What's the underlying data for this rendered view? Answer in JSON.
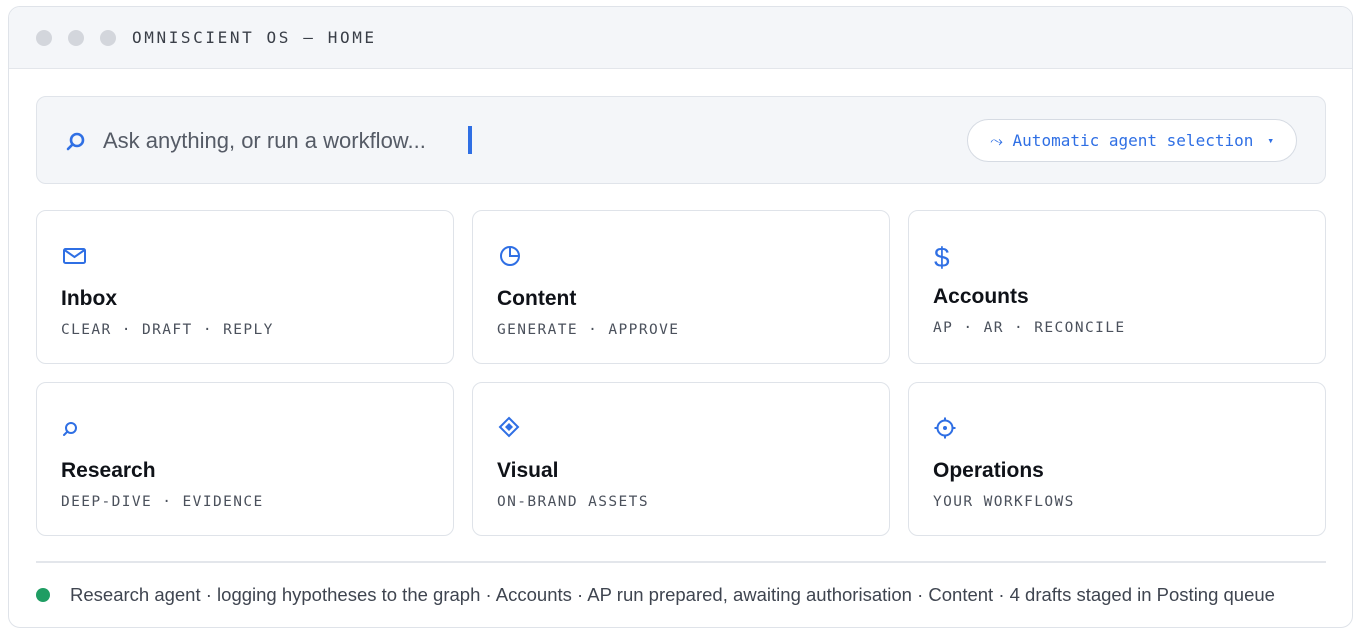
{
  "window": {
    "title": "OMNISCIENT OS — HOME"
  },
  "search": {
    "placeholder": "Ask anything, or run a workflow...",
    "agent_selector": {
      "label": "⤳ Automatic agent selection",
      "chevron": "▾"
    }
  },
  "cards": [
    {
      "title": "Inbox",
      "subtitle": "CLEAR · DRAFT · REPLY",
      "icon": "mail-icon"
    },
    {
      "title": "Content",
      "subtitle": "GENERATE · APPROVE",
      "icon": "pie-chart-icon"
    },
    {
      "title": "Accounts",
      "subtitle": "AP · AR · RECONCILE",
      "icon": "dollar-icon"
    },
    {
      "title": "Research",
      "subtitle": "DEEP-DIVE · EVIDENCE",
      "icon": "search-icon"
    },
    {
      "title": "Visual",
      "subtitle": "ON-BRAND ASSETS",
      "icon": "diamond-icon"
    },
    {
      "title": "Operations",
      "subtitle": "YOUR WORKFLOWS",
      "icon": "target-icon"
    }
  ],
  "status": {
    "text": "Research agent · logging hypotheses to the graph  ·  Accounts · AP run prepared, awaiting authorisation  ·  Content · 4 drafts staged in Posting queue"
  },
  "colors": {
    "accent": "#2f6fe4",
    "status_ok": "#1f9d63",
    "panel": "#f4f6f9",
    "border": "#dfe3e9"
  }
}
